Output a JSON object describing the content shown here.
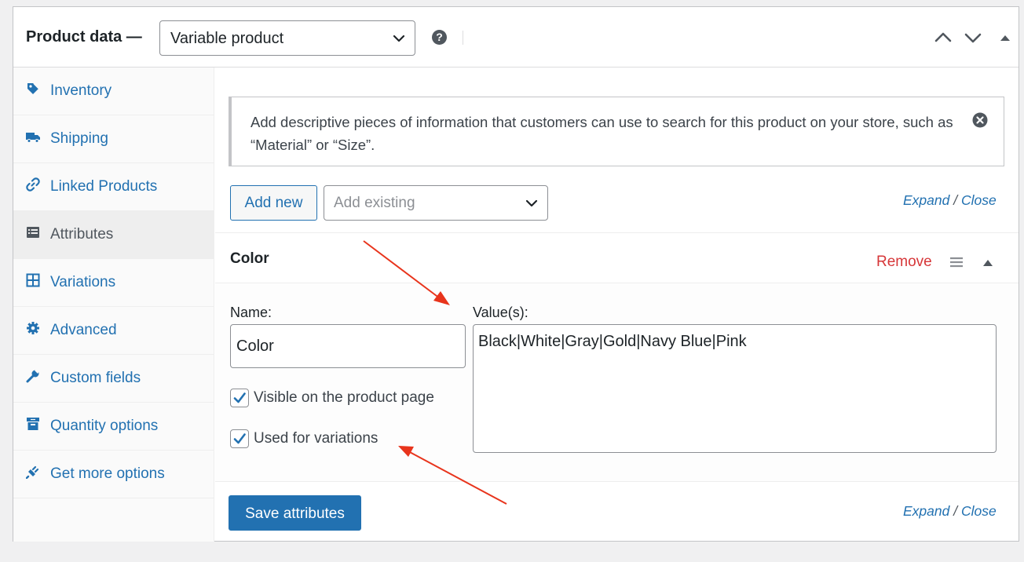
{
  "header": {
    "title": "Product data —",
    "product_type": "Variable product",
    "help_icon": "question-circle-icon",
    "controls": [
      "chevron-up-icon",
      "chevron-down-icon",
      "triangle-up-icon"
    ]
  },
  "sidebar": {
    "items": [
      {
        "label": "Inventory",
        "icon": "tag-icon",
        "active": false
      },
      {
        "label": "Shipping",
        "icon": "truck-icon",
        "active": false
      },
      {
        "label": "Linked Products",
        "icon": "link-icon",
        "active": false
      },
      {
        "label": "Attributes",
        "icon": "list-icon",
        "active": true
      },
      {
        "label": "Variations",
        "icon": "grid-icon",
        "active": false
      },
      {
        "label": "Advanced",
        "icon": "gear-icon",
        "active": false
      },
      {
        "label": "Custom fields",
        "icon": "wrench-icon",
        "active": false
      },
      {
        "label": "Quantity options",
        "icon": "archive-icon",
        "active": false
      },
      {
        "label": "Get more options",
        "icon": "plug-icon",
        "active": false
      }
    ]
  },
  "notice": {
    "text": "Add descriptive pieces of information that customers can use to search for this product on your store, such as “Material” or “Size”."
  },
  "toolbar": {
    "add_new_label": "Add new",
    "add_existing_placeholder": "Add existing",
    "expand_label": "Expand",
    "separator": "/",
    "close_label": "Close"
  },
  "attribute": {
    "title": "Color",
    "remove_label": "Remove",
    "name_label": "Name:",
    "name_value": "Color",
    "values_label": "Value(s):",
    "values_value": "Black|White|Gray|Gold|Navy Blue|Pink",
    "visible_label": "Visible on the product page",
    "visible_checked": true,
    "variations_label": "Used for variations",
    "variations_checked": true
  },
  "footer": {
    "save_label": "Save attributes",
    "expand_label": "Expand",
    "separator": "/",
    "close_label": "Close"
  },
  "colors": {
    "accent": "#2271b1",
    "danger": "#d63638",
    "annotation_arrow": "#e8341c"
  }
}
